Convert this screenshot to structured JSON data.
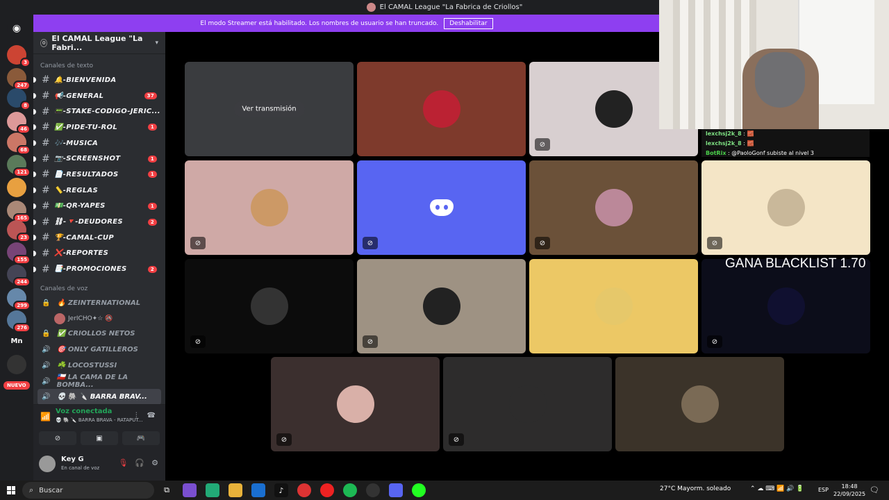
{
  "window": {
    "title": "El CAMAL League \"La Fabrica de Criollos\""
  },
  "streamer": {
    "text": "El modo Streamer está habilitado. Los nombres de usuario se han truncado.",
    "button": "Deshabilitar"
  },
  "guilds": {
    "badges": [
      "3",
      "247",
      "8",
      "46",
      "68",
      "121",
      "165",
      "23",
      "155",
      "244",
      "299",
      "276"
    ],
    "mn": "Mn",
    "nuevo": "NUEVO"
  },
  "server": {
    "name": "El CAMAL League \"La Fabri...",
    "boost_icon": "0"
  },
  "text_category": "Canales de texto",
  "text_channels": [
    {
      "name": "🔔-BIENVENIDA",
      "badge": ""
    },
    {
      "name": "📢-GENERAL",
      "badge": "37"
    },
    {
      "name": "📟-STAKE-CODIGO-JERIC...",
      "badge": ""
    },
    {
      "name": "✅-PIDE-TU-ROL",
      "badge": "1"
    },
    {
      "name": "🎶-MUSICA",
      "badge": ""
    },
    {
      "name": "📷-SCREENSHOT",
      "badge": "1"
    },
    {
      "name": "📄-RESULTADOS",
      "badge": "1"
    },
    {
      "name": "📏-REGLAS",
      "badge": ""
    },
    {
      "name": "💵-QR-YAPES",
      "badge": "1"
    },
    {
      "name": "⛓-🔻-DEUDORES",
      "badge": "2"
    },
    {
      "name": "🏆-CAMAL-CUP",
      "badge": ""
    },
    {
      "name": "❌-REPORTES",
      "badge": ""
    },
    {
      "name": "📑-PROMOCIONES",
      "badge": "2"
    }
  ],
  "voice_category": "Canales de voz",
  "voice_channels": [
    {
      "name": "🔥 ZEINTERNATIONAL",
      "icon": "🔒"
    },
    {
      "name": "✅ CRIOLLOS NETOS",
      "icon": "🔒"
    },
    {
      "name": "🎯 ONLY GATILLEROS",
      "icon": "🔊"
    },
    {
      "name": "☘️ LOCOSTUSSI",
      "icon": "🔊"
    },
    {
      "name": "🇨🇱 LA CAMA DE LA BOMBA...",
      "icon": "🔊"
    },
    {
      "name": "💀 🐘 🔪 BARRA BRAV...",
      "icon": "🔊"
    }
  ],
  "voice_user": "JerICHO✦☆ 🚳",
  "voice_connected": {
    "title": "Voz conectada",
    "subtitle": "💀 🐘 🔪 BARRA BRAVA - RATAPUT..."
  },
  "user": {
    "name": "Key G",
    "status": "En canal de voz"
  },
  "stream_button": "Ver transmisión",
  "chat_lines": [
    {
      "name": "lexchsj2k_8",
      "msg": ": 🧱"
    },
    {
      "name": "lexchsj2k_8",
      "msg": ": 🧱"
    },
    {
      "name": "BotRix",
      "msg": ": @PaoloGonf subiste al nivel 3"
    }
  ],
  "overlay_text": "GANA BLACKLIST 1.70",
  "tile_bg_colors": [
    "#3a3c3f",
    "#7e3a2c",
    "#d8cfd0",
    "#cfa9a6",
    "#5865f2",
    "#6b5139",
    "#f4e5c6",
    "#0c0c0c",
    "#9e9283",
    "#ecc865",
    "#0c0d1a",
    "#3b2f2e",
    "#2d2c2c",
    "#3b3329"
  ],
  "taskbar": {
    "search": "Buscar",
    "weather": "27°C  Mayorm. soleado",
    "lang": "ESP",
    "time": "18:48",
    "date": "22/09/2025"
  }
}
